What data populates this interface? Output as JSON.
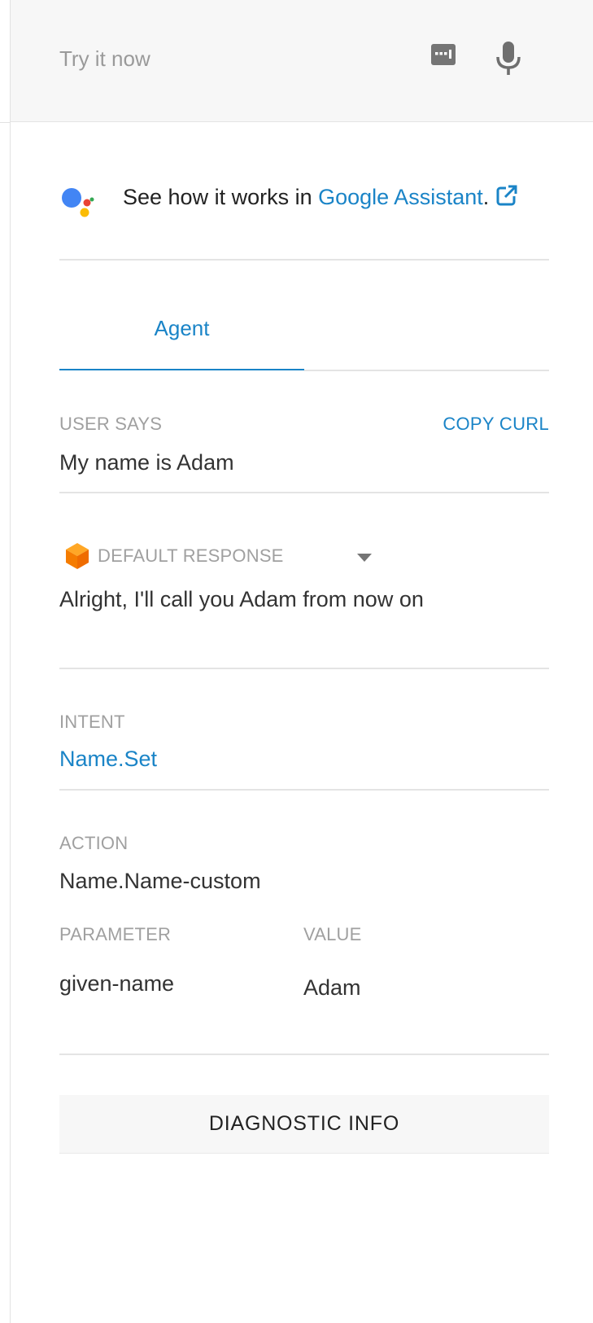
{
  "try_bar": {
    "placeholder": "Try it now",
    "keyboard_icon": "keyboard-icon",
    "mic_icon": "microphone-icon"
  },
  "assistant": {
    "prefix": "See how it works in ",
    "link": "Google Assistant",
    "suffix": ".",
    "logo": "google-assistant-logo",
    "external_icon": "external-link-icon",
    "colors": {
      "blue": "#4285F4",
      "red": "#EA4335",
      "yellow": "#FBBC05",
      "green": "#34A853"
    }
  },
  "tabs": {
    "agent": "Agent"
  },
  "user_says": {
    "caption": "USER SAYS",
    "copy_curl": "COPY CURL",
    "text": "My name is Adam"
  },
  "response": {
    "caption": "DEFAULT RESPONSE",
    "text": "Alright, I'll call you Adam from now on",
    "icon": "dialogflow-cube-icon",
    "icon_color": "#F57C00"
  },
  "intent": {
    "caption": "INTENT",
    "name": "Name.Set"
  },
  "action": {
    "caption": "ACTION",
    "name": "Name.Name-custom"
  },
  "parameters": {
    "header_param": "PARAMETER",
    "header_value": "VALUE",
    "rows": [
      {
        "param": "given-name",
        "value": "Adam"
      }
    ]
  },
  "diagnostic_button": "DIAGNOSTIC INFO",
  "accent_color": "#1A84C7"
}
